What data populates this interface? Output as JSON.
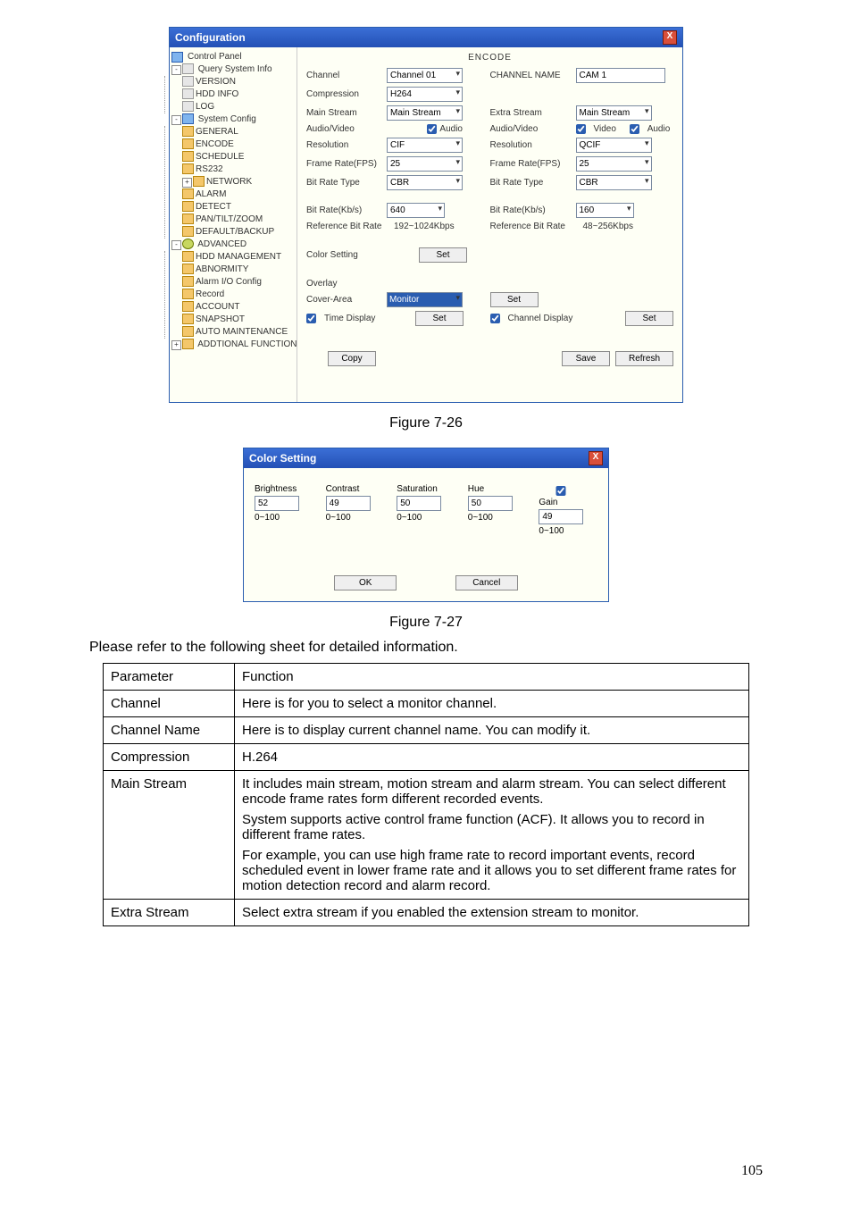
{
  "config_window": {
    "title": "Configuration",
    "section": "ENCODE",
    "tree": {
      "control_panel": "Control Panel",
      "query": "Query System Info",
      "version": "VERSION",
      "hddinfo": "HDD INFO",
      "log": "LOG",
      "sysconfig": "System Config",
      "general": "GENERAL",
      "encode": "ENCODE",
      "schedule": "SCHEDULE",
      "rs232": "RS232",
      "network": "NETWORK",
      "alarm": "ALARM",
      "detect": "DETECT",
      "ptz": "PAN/TILT/ZOOM",
      "backup": "DEFAULT/BACKUP",
      "advanced": "ADVANCED",
      "hddm": "HDD MANAGEMENT",
      "abnorm": "ABNORMITY",
      "alarmio": "Alarm I/O Config",
      "record": "Record",
      "account": "ACCOUNT",
      "snapshot": "SNAPSHOT",
      "automaint": "AUTO MAINTENANCE",
      "addfunc": "ADDTIONAL FUNCTION"
    },
    "labels": {
      "channel": "Channel",
      "channel_name": "CHANNEL NAME",
      "compression": "Compression",
      "main_stream": "Main Stream",
      "extra_stream": "Extra Stream",
      "audiovideo": "Audio/Video",
      "resolution": "Resolution",
      "framerate": "Frame Rate(FPS)",
      "bitratetype": "Bit Rate Type",
      "bitrate": "Bit Rate(Kb/s)",
      "refbitrate": "Reference Bit Rate",
      "colorsetting": "Color Setting",
      "overlay": "Overlay",
      "coverarea": "Cover-Area",
      "timedisplay": "Time Display",
      "channeldisplay": "Channel Display",
      "audio_cb": "Audio",
      "video_cb": "Video"
    },
    "values": {
      "channel": "Channel 01",
      "channel_name": "CAM 1",
      "compression": "H264",
      "main_stream_l": "Main Stream",
      "extra_stream_r": "Main Stream",
      "res_l": "CIF",
      "res_r": "QCIF",
      "fps_l": "25",
      "fps_r": "25",
      "brt_l": "CBR",
      "brt_r": "CBR",
      "br_l": "640",
      "br_r": "160",
      "ref_l": "192~1024Kbps",
      "ref_r": "48~256Kbps",
      "coverarea": "Monitor"
    },
    "buttons": {
      "set": "Set",
      "copy": "Copy",
      "save": "Save",
      "refresh": "Refresh"
    }
  },
  "colorsetting_window": {
    "title": "Color Setting",
    "labels": {
      "brightness": "Brightness",
      "contrast": "Contrast",
      "saturation": "Saturation",
      "hue": "Hue",
      "gain": "Gain",
      "range": "0~100"
    },
    "values": {
      "brightness": "52",
      "contrast": "49",
      "saturation": "50",
      "hue": "50",
      "gain": "49"
    },
    "buttons": {
      "ok": "OK",
      "cancel": "Cancel"
    }
  },
  "captions": {
    "fig1": "Figure 7-26",
    "fig2": "Figure 7-27",
    "intro": "Please refer to the following sheet for detailed information."
  },
  "table": {
    "h1": "Parameter",
    "h2": "Function",
    "rows": [
      {
        "p": "Channel",
        "f": [
          "Here is for you to select a monitor channel."
        ]
      },
      {
        "p": "Channel Name",
        "f": [
          "Here is to display current channel name. You can modify it."
        ]
      },
      {
        "p": "Compression",
        "f": [
          "H.264"
        ]
      },
      {
        "p": "Main Stream",
        "f": [
          "It includes main stream, motion stream and alarm stream. You can select different encode frame rates form different recorded events.",
          "System supports active control frame function (ACF). It allows you to record in different frame rates.",
          "For example, you can use high frame rate to record important events, record scheduled event in lower frame rate and it allows you to set different frame rates for motion detection record and alarm record."
        ]
      },
      {
        "p": "Extra Stream",
        "f": [
          "Select extra stream if you enabled the extension stream to monitor."
        ]
      }
    ]
  },
  "page_number": "105"
}
